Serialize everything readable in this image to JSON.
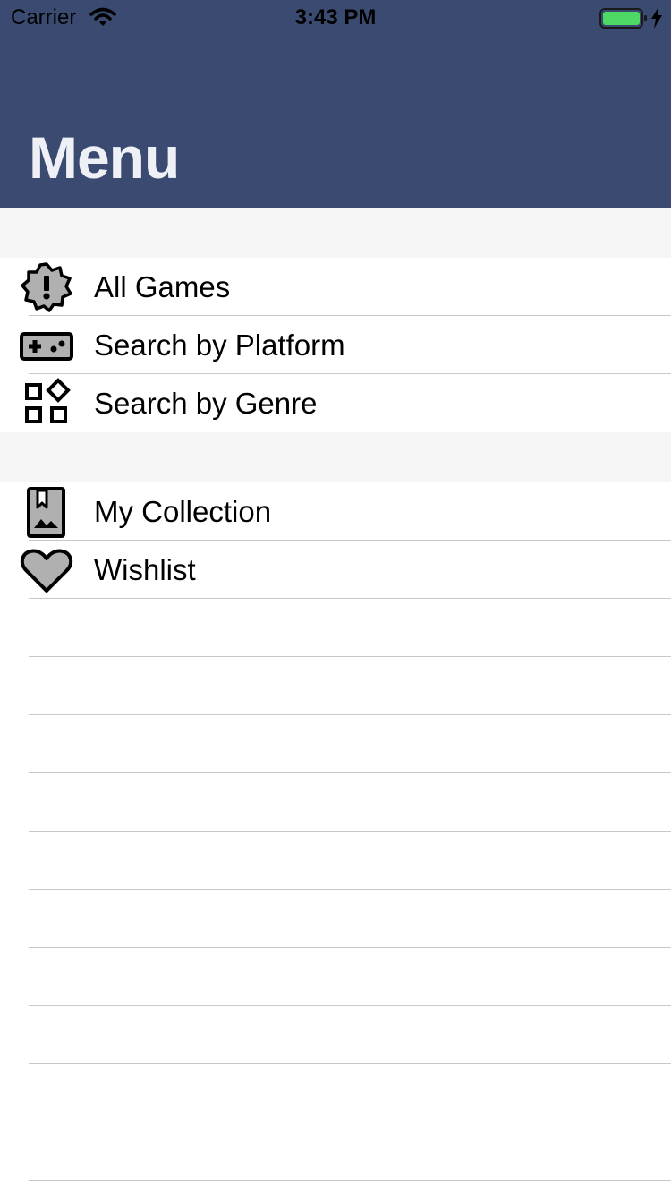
{
  "status_bar": {
    "carrier": "Carrier",
    "time": "3:43 PM",
    "battery_color": "#4cd964"
  },
  "header": {
    "title": "Menu",
    "background": "#3b4a71"
  },
  "sections": [
    {
      "items": [
        {
          "label": "All Games",
          "icon": "badge-alert-icon"
        },
        {
          "label": "Search by Platform",
          "icon": "gamepad-icon"
        },
        {
          "label": "Search by Genre",
          "icon": "category-shapes-icon"
        }
      ]
    },
    {
      "items": [
        {
          "label": "My Collection",
          "icon": "photo-bookmark-icon"
        },
        {
          "label": "Wishlist",
          "icon": "heart-icon"
        }
      ]
    }
  ]
}
